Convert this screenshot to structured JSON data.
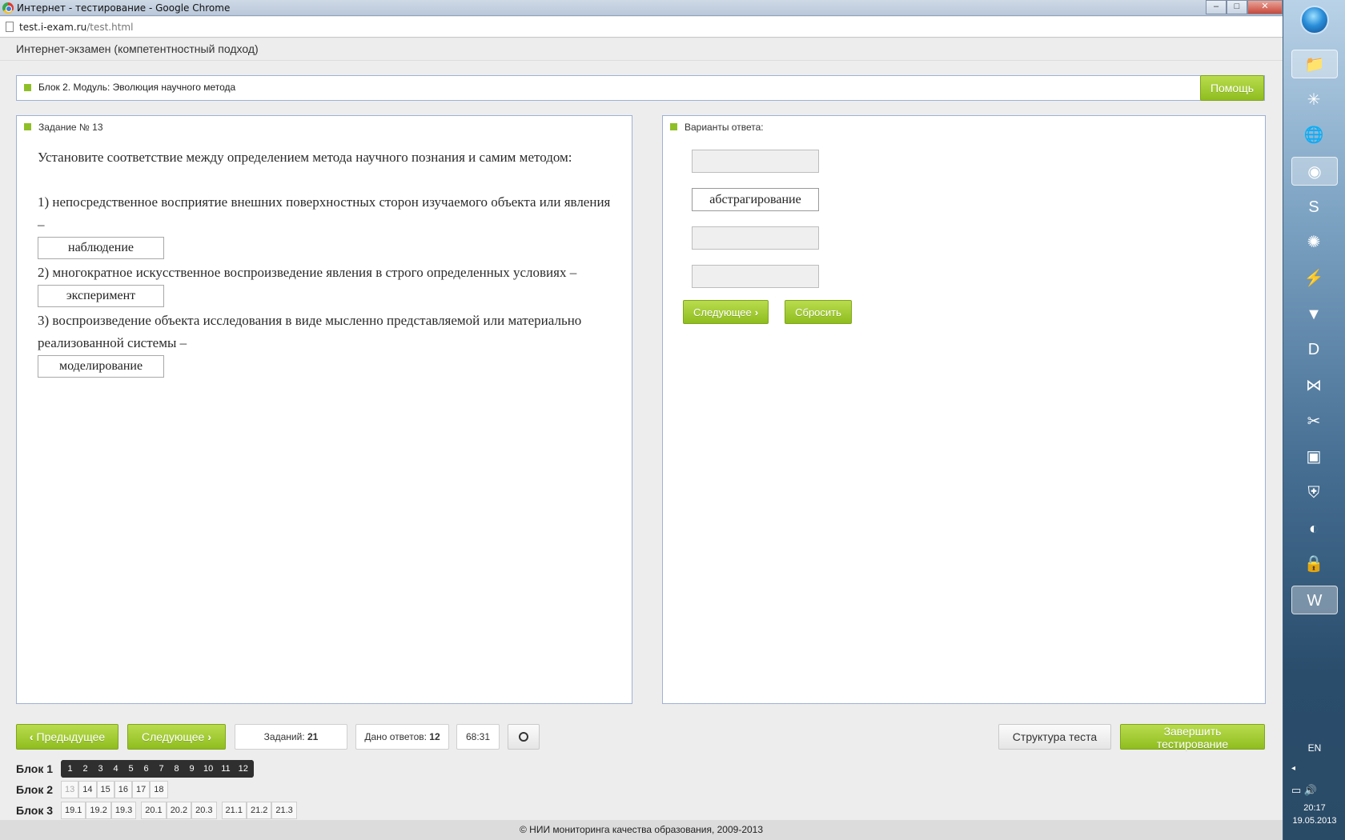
{
  "window": {
    "title": "Интернет - тестирование - Google Chrome",
    "url_host": "test.i-exam.ru",
    "url_path": "/test.html",
    "controls": [
      "–",
      "□",
      "✕"
    ]
  },
  "app": {
    "title": "Интернет-экзамен (компетентностный подход)",
    "block_label": "Блок 2. Модуль: Эволюция научного метода",
    "help_label": "Помощь",
    "accent_color": "#8fbd1f"
  },
  "task": {
    "heading": "Задание № 13",
    "intro": "Установите соответствие между определением метода научного познания и самим методом:",
    "items": [
      {
        "text": "1) непосредственное восприятие внешних поверхностных сторон изучаемого объекта или явления –",
        "answer": "наблюдение"
      },
      {
        "text": "2) многократное искусственное воспроизведение явления в строго определенных условиях –",
        "answer": "эксперимент"
      },
      {
        "text": "3) воспроизведение объекта исследования в виде мысленно представляемой или материально реализованной системы –",
        "answer": "моделирование"
      }
    ]
  },
  "answers": {
    "heading": "Варианты ответа:",
    "options": [
      "",
      "абстрагирование",
      "",
      ""
    ],
    "next_label": "Следующее",
    "reset_label": "Сбросить"
  },
  "nav": {
    "prev_label": "Предыдущее",
    "next_label": "Следующее",
    "tasks_label": "Заданий:",
    "tasks_count": "21",
    "answered_label": "Дано ответов:",
    "answered_count": "12",
    "timer": "68:31",
    "structure_label": "Структура теста",
    "finish_label": "Завершить тестирование"
  },
  "blocks": [
    {
      "label": "Блок 1",
      "groups": [
        [
          "1",
          "2",
          "3",
          "4",
          "5",
          "6",
          "7",
          "8",
          "9",
          "10",
          "11",
          "12"
        ]
      ],
      "state": "done"
    },
    {
      "label": "Блок 2",
      "groups": [
        [
          "13",
          "14",
          "15",
          "16",
          "17",
          "18"
        ]
      ],
      "state": "open",
      "current": "13"
    },
    {
      "label": "Блок 3",
      "groups": [
        [
          "19.1",
          "19.2",
          "19.3"
        ],
        [
          "20.1",
          "20.2",
          "20.3"
        ],
        [
          "21.1",
          "21.2",
          "21.3"
        ]
      ],
      "state": "open"
    }
  ],
  "footer": "© НИИ мониторинга качества образования, 2009-2013",
  "taskbar": {
    "icons": [
      "folder-icon",
      "network-icon",
      "globe-icon",
      "chrome-icon",
      "skype-icon",
      "media-icon",
      "flash-icon",
      "fox-icon",
      "d-icon",
      "bowtie-icon",
      "tool-icon",
      "monitor-icon",
      "shield-icon",
      "ccleaner-icon",
      "lock-icon",
      "word-icon"
    ],
    "active": [
      "chrome-icon",
      "word-icon"
    ],
    "lang": "EN",
    "time": "20:17",
    "date": "19.05.2013"
  }
}
